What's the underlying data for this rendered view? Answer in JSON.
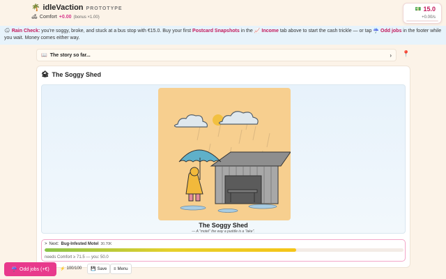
{
  "header": {
    "app_icon": "palm-tree-icon",
    "app_name": "idleVaction",
    "tag": "PROTOTYPE",
    "comfort_icon": "comfort-icon",
    "comfort_label": "Comfort",
    "comfort_value": "+0.00",
    "comfort_bonus": "(bonus ×1.00)",
    "money_icon": "cash-icon",
    "money": "15.0",
    "rate": "+0.00/s"
  },
  "tip": {
    "icon": "rain-cloud-icon",
    "title": "Rain Check:",
    "text1": " you're soggy, broke, and stuck at a bus stop with €15.0. Buy your first ",
    "link1": "Postcard Snapshots",
    "text2": " in the ",
    "link2_icon": "chart-icon",
    "link2": "Income",
    "text3": " tab above to start the cash trickle — or tap ",
    "link3_icon": "umbrella-icon",
    "link3": "Odd jobs",
    "text4": " in the footer while you wait. Money comes either way."
  },
  "story": {
    "icon": "book-icon",
    "label": "The story so far...",
    "chevron": "›",
    "pin_icon": "pin-icon"
  },
  "location": {
    "icon": "shed-icon",
    "title": "The Soggy Shed",
    "scene_title": "The Soggy Shed",
    "scene_subtitle": "— A \"motel\" the way a puddle is a \"lake\"."
  },
  "next": {
    "arrow": ">",
    "label": "Next:",
    "name": "Bug-Infested Motel",
    "cost": "30.70K",
    "requirement": "needs Comfort ≥ 71.5 — you: 50.0",
    "progress": 0.7
  },
  "footer": {
    "odd_jobs_icon": "umbrella-icon",
    "odd_jobs": "Odd jobs (+€)",
    "energy_icon": "lightning-icon",
    "energy": "100/100",
    "save_icon": "floppy-icon",
    "save": "Save",
    "menu_icon": "hamburger-icon",
    "menu": "Menu"
  },
  "colors": {
    "accent": "#e8398c",
    "banner": "#e7f3fb",
    "background": "#fcf3e8",
    "art_background": "#f7cf8f"
  }
}
